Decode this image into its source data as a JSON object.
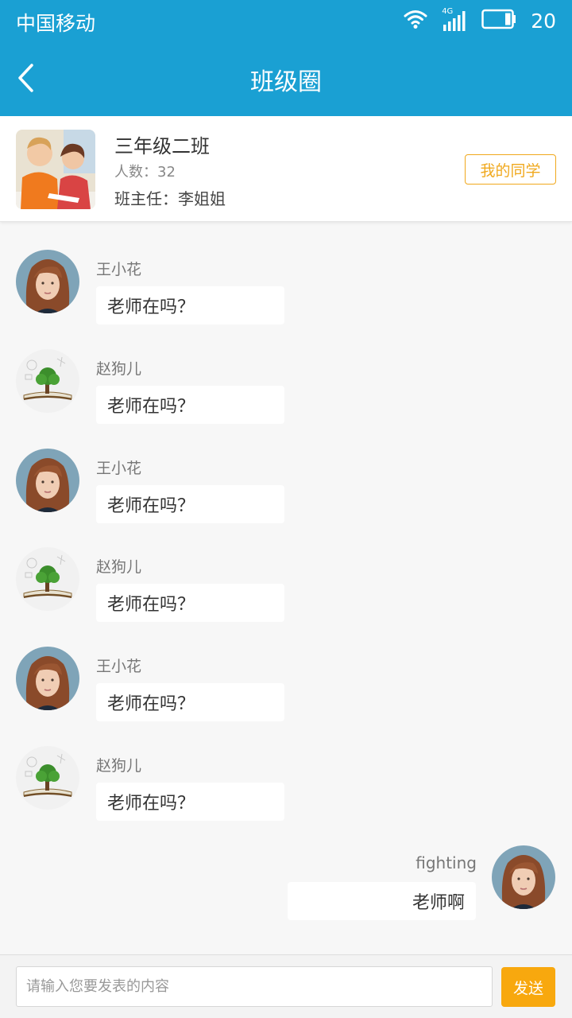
{
  "status_bar": {
    "carrier": "中国移动",
    "network": "4G",
    "battery": "20"
  },
  "header": {
    "title": "班级圈"
  },
  "class_info": {
    "name": "三年级二班",
    "count_label": "人数：",
    "count": "32",
    "teacher_label": "班主任：",
    "teacher": "李姐姐",
    "classmates_button": "我的同学"
  },
  "messages": [
    {
      "sender": "王小花",
      "text": "老师在吗？",
      "side": "left",
      "avatar": "girl-portrait"
    },
    {
      "sender": "赵狗儿",
      "text": "老师在吗？",
      "side": "left",
      "avatar": "tree-book"
    },
    {
      "sender": "王小花",
      "text": "老师在吗？",
      "side": "left",
      "avatar": "girl-portrait"
    },
    {
      "sender": "赵狗儿",
      "text": "老师在吗？",
      "side": "left",
      "avatar": "tree-book"
    },
    {
      "sender": "王小花",
      "text": "老师在吗？",
      "side": "left",
      "avatar": "girl-portrait"
    },
    {
      "sender": "赵狗儿",
      "text": "老师在吗？",
      "side": "left",
      "avatar": "tree-book"
    },
    {
      "sender": "fighting",
      "text": "老师啊",
      "side": "right",
      "avatar": "girl-portrait"
    }
  ],
  "composer": {
    "placeholder": "请输入您要发表的内容",
    "send_label": "发送"
  },
  "colors": {
    "header": "#1aa0d3",
    "accent": "#f8a80e",
    "classmates_border": "#f0a81c",
    "background": "#f7f7f7"
  }
}
